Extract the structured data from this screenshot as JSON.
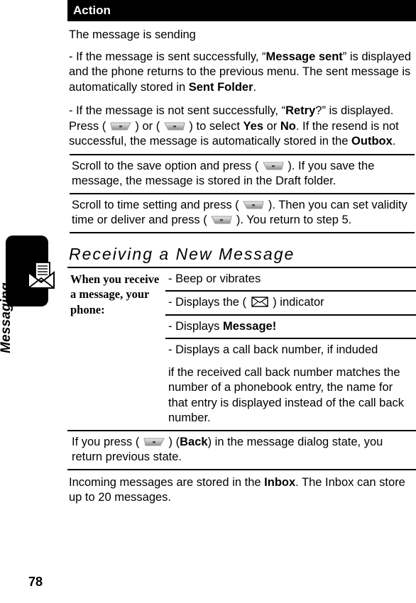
{
  "page": {
    "number": "78"
  },
  "sidebar": {
    "label": "Messaging",
    "icon": "envelope-document-icon"
  },
  "header": {
    "title": "Action"
  },
  "action_steps": [
    {
      "id": "sending",
      "text": "The message is sending"
    },
    {
      "id": "sent-success",
      "segments": [
        {
          "t": "- If the message is sent successfully, “"
        },
        {
          "t": "Message sent",
          "b": true
        },
        {
          "t": "” is displayed and the phone returns to the previous menu. The sent message is automatically stored in "
        },
        {
          "t": "Sent Folder",
          "b": true
        },
        {
          "t": "."
        }
      ]
    },
    {
      "id": "sent-fail",
      "segments": [
        {
          "t": "- If the message is not sent successfully, “"
        },
        {
          "t": "Retry",
          "b": true
        },
        {
          "t": "?” is displayed. Press ( "
        },
        {
          "icon": "left-softkey-icon"
        },
        {
          "t": " ) or ( "
        },
        {
          "icon": "right-softkey-icon"
        },
        {
          "t": " ) to select "
        },
        {
          "t": "Yes",
          "b": true
        },
        {
          "t": " or "
        },
        {
          "t": "No",
          "b": true
        },
        {
          "t": ". If the resend is not successful, the message is automatically stored in the "
        },
        {
          "t": "Outbox",
          "b": true
        },
        {
          "t": "."
        }
      ]
    }
  ],
  "boxed_steps": [
    {
      "id": "save-option",
      "segments": [
        {
          "t": "Scroll to the save option and press ( "
        },
        {
          "icon": "right-softkey-icon"
        },
        {
          "t": " ). If you save the message, the message is stored in the Draft folder."
        }
      ]
    },
    {
      "id": "time-setting",
      "segments": [
        {
          "t": "Scroll to time setting and press ( "
        },
        {
          "icon": "right-softkey-icon"
        },
        {
          "t": " ). Then you can set validity time or deliver and press ( "
        },
        {
          "icon": "right-softkey-icon"
        },
        {
          "t": " ). You return to step 5."
        }
      ]
    }
  ],
  "section": {
    "heading": "Receiving a New Message"
  },
  "receive_table": {
    "label": "When you receive a message, your phone:",
    "rows": [
      {
        "id": "beep",
        "segments": [
          {
            "t": "- Beep or vibrates"
          }
        ]
      },
      {
        "id": "indicator",
        "segments": [
          {
            "t": "- Displays the ( "
          },
          {
            "icon": "envelope-indicator-icon"
          },
          {
            "t": " ) indicator"
          }
        ]
      },
      {
        "id": "message-alert",
        "segments": [
          {
            "t": "- Displays "
          },
          {
            "t": "Message!",
            "b": true
          }
        ]
      },
      {
        "id": "callback-number",
        "segments": [
          {
            "t": "- Displays a call back number, if induded"
          }
        ]
      },
      {
        "id": "phonebook-match",
        "segments": [
          {
            "t": "if the received call back number matches the number of a phonebook entry, the name for that entry is displayed instead of the call back number."
          }
        ]
      }
    ]
  },
  "back_step": {
    "id": "back-press",
    "segments": [
      {
        "t": "If you press ( "
      },
      {
        "icon": "left-softkey-icon"
      },
      {
        "t": " ) ("
      },
      {
        "t": "Back",
        "b": true
      },
      {
        "t": ") in the message dialog state, you return previous state."
      }
    ]
  },
  "footer_note": {
    "id": "inbox-note",
    "segments": [
      {
        "t": "Incoming messages are stored in the "
      },
      {
        "t": "Inbox",
        "b": true
      },
      {
        "t": ". The Inbox can store up to 20 messages."
      }
    ]
  }
}
